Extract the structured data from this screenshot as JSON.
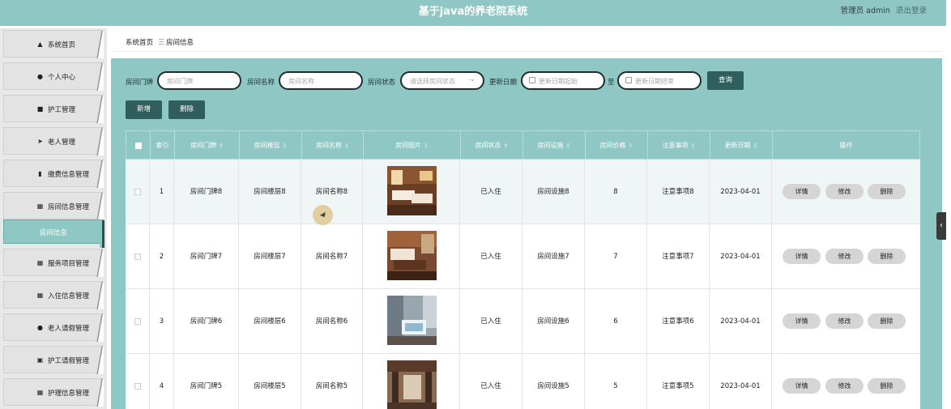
{
  "header": {
    "title": "基于java的养老院系统",
    "user": "管理员 admin",
    "logout": "退出登录"
  },
  "sidebar": {
    "items": [
      {
        "label": "系统首页",
        "icon": "home-icon"
      },
      {
        "label": "个人中心",
        "icon": "user-icon"
      },
      {
        "label": "护工管理",
        "icon": "caregiver-icon"
      },
      {
        "label": "老人管理",
        "icon": "send-icon"
      },
      {
        "label": "缴费信息管理",
        "icon": "bar-chart-icon"
      },
      {
        "label": "房间信息管理",
        "icon": "grid-icon"
      },
      {
        "label": "房间信息",
        "icon": ""
      },
      {
        "label": "服务项目管理",
        "icon": "grid-icon"
      },
      {
        "label": "入住信息管理",
        "icon": "grid-icon"
      },
      {
        "label": "老人请假管理",
        "icon": "user-icon"
      },
      {
        "label": "护工请假管理",
        "icon": "clipboard-icon"
      },
      {
        "label": "护理信息管理",
        "icon": "grid-icon"
      }
    ]
  },
  "breadcrumb": {
    "home": "系统首页",
    "sep": "三",
    "current": "房间信息"
  },
  "search": {
    "room_no_label": "房间门牌",
    "room_no_placeholder": "房间门牌",
    "room_name_label": "房间名称",
    "room_name_placeholder": "房间名称",
    "status_label": "房间状态",
    "status_placeholder": "请选择房间状态",
    "date_label": "更新日期",
    "date_start_placeholder": "更新日期起始",
    "date_to": "至",
    "date_end_placeholder": "更新日期结束",
    "query_button": "查询"
  },
  "actions": {
    "add": "新增",
    "delete": "删除"
  },
  "table": {
    "columns": [
      "",
      "索引",
      "房间门牌",
      "房间楼层",
      "房间名称",
      "房间图片",
      "房间状态",
      "房间设施",
      "房间价格",
      "注意事项",
      "更新日期",
      "操作"
    ],
    "rows": [
      {
        "index": "1",
        "room_no": "房间门牌8",
        "floor": "房间楼层8",
        "name": "房间名称8",
        "status": "已入住",
        "facility": "房间设施8",
        "price": "8",
        "notes": "注意事项8",
        "date": "2023-04-01"
      },
      {
        "index": "2",
        "room_no": "房间门牌7",
        "floor": "房间楼层7",
        "name": "房间名称7",
        "status": "已入住",
        "facility": "房间设施7",
        "price": "7",
        "notes": "注意事项7",
        "date": "2023-04-01"
      },
      {
        "index": "3",
        "room_no": "房间门牌6",
        "floor": "房间楼层6",
        "name": "房间名称6",
        "status": "已入住",
        "facility": "房间设施6",
        "price": "6",
        "notes": "注意事项6",
        "date": "2023-04-01"
      },
      {
        "index": "4",
        "room_no": "房间门牌5",
        "floor": "房间楼层5",
        "name": "房间名称5",
        "status": "已入住",
        "facility": "房间设施5",
        "price": "5",
        "notes": "注意事项5",
        "date": "2023-04-01"
      }
    ],
    "op_detail": "详情",
    "op_edit": "修改",
    "op_delete": "删除"
  },
  "colors": {
    "accent": "#8fc7c4",
    "dark_button": "#2f5e5c"
  }
}
